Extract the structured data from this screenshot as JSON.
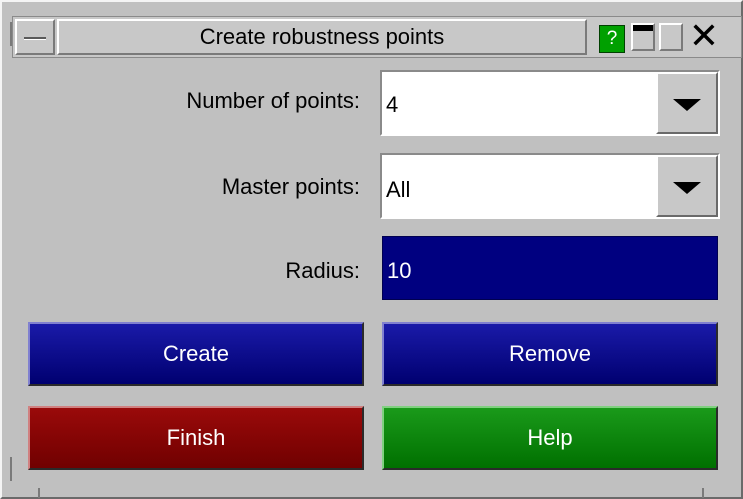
{
  "window": {
    "title": "Create robustness points",
    "help_icon_label": "?"
  },
  "form": {
    "number_of_points": {
      "label": "Number of points:",
      "value": "4"
    },
    "master_points": {
      "label": "Master points:",
      "value": "All"
    },
    "radius": {
      "label": "Radius:",
      "value": "10"
    }
  },
  "buttons": {
    "create": "Create",
    "remove": "Remove",
    "finish": "Finish",
    "help": "Help"
  },
  "colors": {
    "background": "#c0c0c0",
    "blue_button": "#000080",
    "red_button": "#800000",
    "green_button": "#008000",
    "help_icon": "#00a000"
  },
  "icons": {
    "menu": "menu-bar-icon",
    "help": "question-icon",
    "minimize": "minimize-icon",
    "maximize": "maximize-icon",
    "close": "close-icon",
    "dropdown": "chevron-down-icon"
  }
}
